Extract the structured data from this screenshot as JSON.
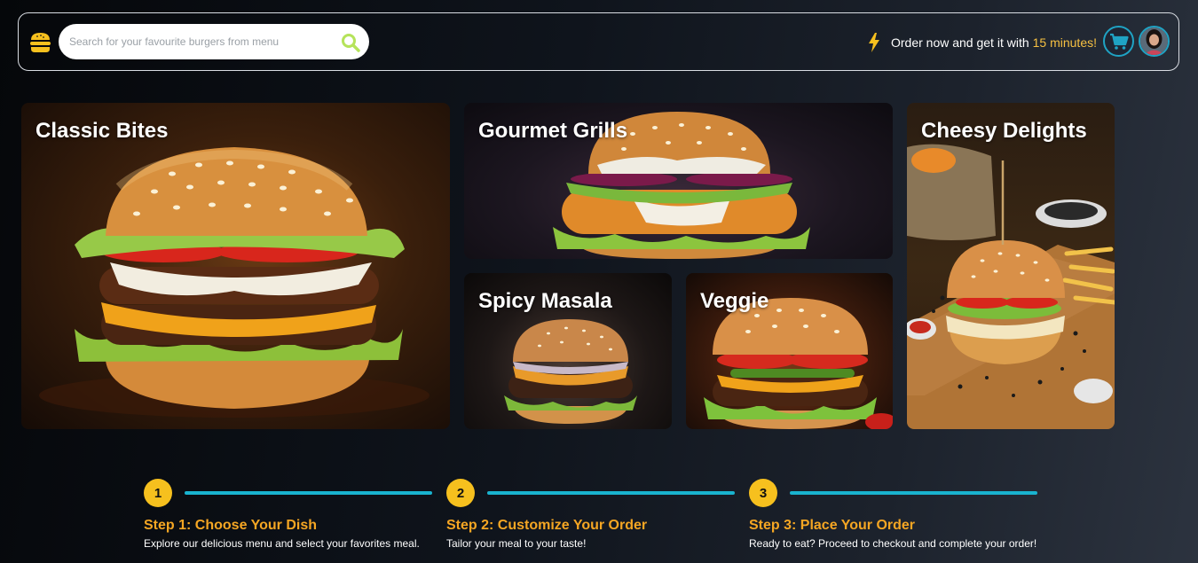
{
  "header": {
    "search_placeholder": "Search for your favourite burgers from menu",
    "promo_text": "Order now and get it with",
    "promo_highlight": "15 minutes!",
    "icons": {
      "logo": "burger-logo-icon",
      "search": "search-icon",
      "bolt": "lightning-bolt-icon",
      "cart": "cart-icon"
    },
    "colors": {
      "accent": "#f6c042",
      "ring": "#1fa3c4",
      "search_icon": "#b5e35a"
    }
  },
  "categories": [
    {
      "title": "Classic Bites"
    },
    {
      "title": "Gourmet Grills"
    },
    {
      "title": "Spicy Masala"
    },
    {
      "title": "Veggie"
    },
    {
      "title": "Cheesy Delights"
    }
  ],
  "steps": [
    {
      "number": "1",
      "title": "Step 1: Choose Your Dish",
      "desc": "Explore our delicious menu and select your favorites meal."
    },
    {
      "number": "2",
      "title": "Step 2: Customize Your Order",
      "desc": "Tailor your meal to your taste!"
    },
    {
      "number": "3",
      "title": "Step 3: Place Your Order",
      "desc": "Ready to eat? Proceed to checkout and complete your order!"
    }
  ],
  "colors": {
    "step_badge": "#f6c01e",
    "step_line": "#19b3cf",
    "step_title": "#f5a623"
  }
}
